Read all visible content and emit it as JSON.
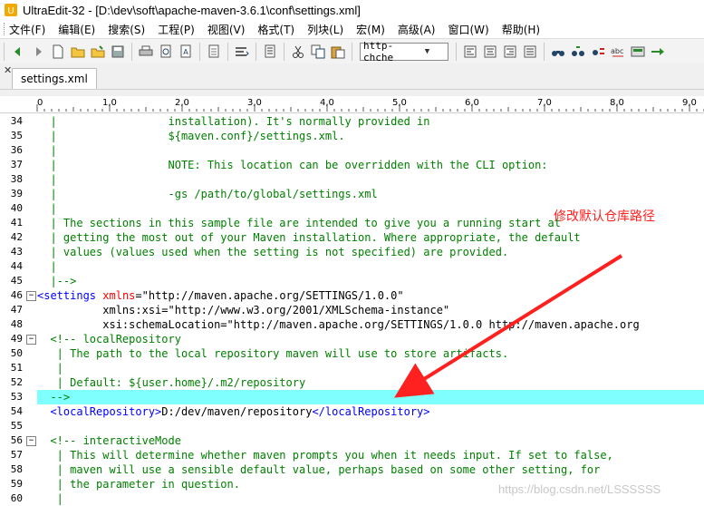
{
  "window": {
    "title": "UltraEdit-32 - [D:\\dev\\soft\\apache-maven-3.6.1\\conf\\settings.xml]"
  },
  "menu": {
    "items": [
      "文件(F)",
      "编辑(E)",
      "搜索(S)",
      "工程(P)",
      "视图(V)",
      "格式(T)",
      "列块(L)",
      "宏(M)",
      "高级(A)",
      "窗口(W)",
      "帮助(H)"
    ]
  },
  "toolbar": {
    "syntax_combo": "http-chche",
    "icons": [
      "back-icon",
      "forward-icon",
      "new-file-icon",
      "open-folder-icon",
      "open-icon",
      "save-icon",
      "print-icon",
      "print-preview-icon",
      "spell-check-icon",
      "page-icon",
      "wrap-icon",
      "hex-icon",
      "cut-icon",
      "copy-icon",
      "paste-icon",
      "align-left-icon",
      "align-center-icon",
      "align-right-icon",
      "justify-icon",
      "find-icon",
      "find-next-icon",
      "replace-icon",
      "abc-icon",
      "compare-icon",
      "tile-icon"
    ]
  },
  "tabs": [
    {
      "label": "settings.xml",
      "active": true
    }
  ],
  "ruler": {
    "labels": [
      "0",
      "1,0",
      "2,0",
      "3,0",
      "4,0",
      "5,0",
      "6,0",
      "7,0",
      "8,0",
      "9,0"
    ]
  },
  "editor": {
    "first_line": 34,
    "highlight_line": 53,
    "fold_lines": [
      46,
      49,
      56
    ],
    "lines": [
      {
        "n": "34",
        "text": "  |                 installation). It's normally provided in",
        "kind": "com"
      },
      {
        "n": "35",
        "text": "  |                 ${maven.conf}/settings.xml.",
        "kind": "com"
      },
      {
        "n": "36",
        "text": "  |",
        "kind": "com"
      },
      {
        "n": "37",
        "text": "  |                 NOTE: This location can be overridden with the CLI option:",
        "kind": "com"
      },
      {
        "n": "38",
        "text": "  |",
        "kind": "com"
      },
      {
        "n": "39",
        "text": "  |                 -gs /path/to/global/settings.xml",
        "kind": "com"
      },
      {
        "n": "40",
        "text": "  |",
        "kind": "com"
      },
      {
        "n": "41",
        "text": "  | The sections in this sample file are intended to give you a running start at",
        "kind": "com"
      },
      {
        "n": "42",
        "text": "  | getting the most out of your Maven installation. Where appropriate, the default",
        "kind": "com"
      },
      {
        "n": "43",
        "text": "  | values (values used when the setting is not specified) are provided.",
        "kind": "com"
      },
      {
        "n": "44",
        "text": "  |",
        "kind": "com"
      },
      {
        "n": "45",
        "text": "  |-->",
        "kind": "com"
      },
      {
        "n": "46",
        "text": "",
        "kind": "settings_open"
      },
      {
        "n": "47",
        "text": "",
        "kind": "xsi"
      },
      {
        "n": "48",
        "text": "",
        "kind": "schema"
      },
      {
        "n": "49",
        "text": "  <!-- localRepository",
        "kind": "com"
      },
      {
        "n": "50",
        "text": "   | The path to the local repository maven will use to store artifacts.",
        "kind": "com"
      },
      {
        "n": "51",
        "text": "   |",
        "kind": "com"
      },
      {
        "n": "52",
        "text": "   | Default: ${user.home}/.m2/repository",
        "kind": "com"
      },
      {
        "n": "53",
        "text": "  -->",
        "kind": "com"
      },
      {
        "n": "54",
        "text": "",
        "kind": "localrepo"
      },
      {
        "n": "55",
        "text": "",
        "kind": "blank"
      },
      {
        "n": "56",
        "text": "  <!-- interactiveMode",
        "kind": "com"
      },
      {
        "n": "57",
        "text": "   | This will determine whether maven prompts you when it needs input. If set to false,",
        "kind": "com"
      },
      {
        "n": "58",
        "text": "   | maven will use a sensible default value, perhaps based on some other setting, for",
        "kind": "com"
      },
      {
        "n": "59",
        "text": "   | the parameter in question.",
        "kind": "com"
      },
      {
        "n": "60",
        "text": "   |",
        "kind": "com"
      }
    ],
    "tokens": {
      "settings_tag_open": "<settings",
      "xmlns_attr": "xmlns",
      "xmlns_val": "=\"http://maven.apache.org/SETTINGS/1.0.0\"",
      "xsi_line": "          xmlns:xsi=\"http://www.w3.org/2001/XMLSchema-instance\"",
      "schema_line": "          xsi:schemaLocation=\"http://maven.apache.org/SETTINGS/1.0.0 http://maven.apache.org",
      "lr_open": "<localRepository>",
      "lr_value": "D:/dev/maven/repository",
      "lr_close": "</localRepository>"
    }
  },
  "annotation": {
    "text": "修改默认仓库路径",
    "color": "#ff2020"
  },
  "watermark": "https://blog.csdn.net/LSSSSSS",
  "colors": {
    "comment": "#008000",
    "tag": "#0000ff",
    "attr": "#ff0000",
    "highlight": "#80ffff"
  }
}
